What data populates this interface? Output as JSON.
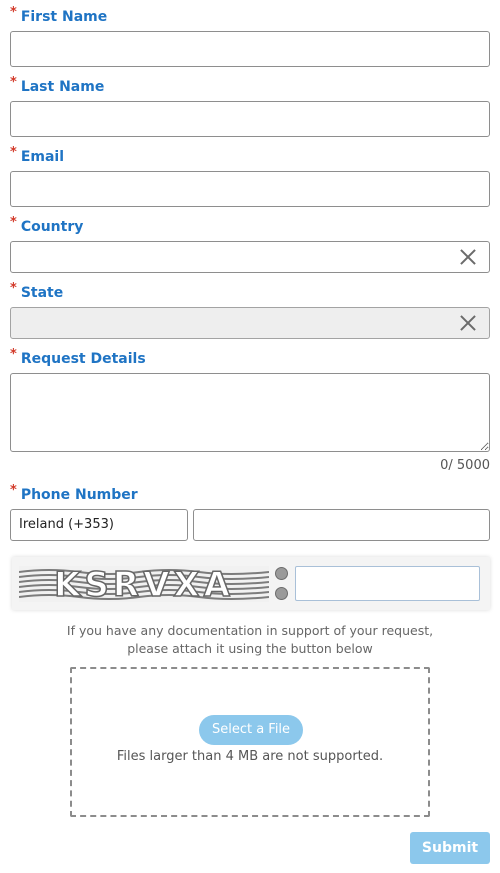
{
  "form": {
    "first_name": {
      "label": "First Name",
      "required_mark": "*",
      "value": ""
    },
    "last_name": {
      "label": "Last Name",
      "required_mark": "*",
      "value": ""
    },
    "email": {
      "label": "Email",
      "required_mark": "*",
      "value": ""
    },
    "country": {
      "label": "Country",
      "required_mark": "*",
      "value": ""
    },
    "state": {
      "label": "State",
      "required_mark": "*",
      "value": "",
      "disabled": true
    },
    "request_details": {
      "label": "Request Details",
      "required_mark": "*",
      "value": "",
      "counter": "0/ 5000"
    },
    "phone": {
      "label": "Phone Number",
      "required_mark": "*",
      "country_code": "Ireland (+353)",
      "number": ""
    }
  },
  "captcha": {
    "text": "KSRVXA",
    "answer": ""
  },
  "attachment": {
    "note_line1": "If you have any documentation in support of your request,",
    "note_line2": "please attach it using the button below",
    "select_label": "Select a File",
    "size_note": "Files larger than 4 MB are not supported."
  },
  "submit_label": "Submit",
  "colors": {
    "label": "#1f74c4",
    "required": "#d23a2a",
    "button": "#8cc8ec"
  },
  "icons": [
    "clear-icon",
    "refresh-icon",
    "audio-icon"
  ]
}
